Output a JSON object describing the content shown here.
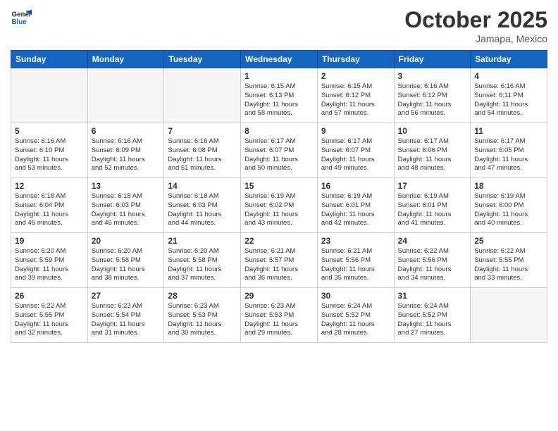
{
  "header": {
    "logo_general": "General",
    "logo_blue": "Blue",
    "month": "October 2025",
    "location": "Jamapa, Mexico"
  },
  "days_of_week": [
    "Sunday",
    "Monday",
    "Tuesday",
    "Wednesday",
    "Thursday",
    "Friday",
    "Saturday"
  ],
  "weeks": [
    [
      {
        "day": "",
        "info": ""
      },
      {
        "day": "",
        "info": ""
      },
      {
        "day": "",
        "info": ""
      },
      {
        "day": "1",
        "info": "Sunrise: 6:15 AM\nSunset: 6:13 PM\nDaylight: 11 hours\nand 58 minutes."
      },
      {
        "day": "2",
        "info": "Sunrise: 6:15 AM\nSunset: 6:12 PM\nDaylight: 11 hours\nand 57 minutes."
      },
      {
        "day": "3",
        "info": "Sunrise: 6:16 AM\nSunset: 6:12 PM\nDaylight: 11 hours\nand 56 minutes."
      },
      {
        "day": "4",
        "info": "Sunrise: 6:16 AM\nSunset: 6:11 PM\nDaylight: 11 hours\nand 54 minutes."
      }
    ],
    [
      {
        "day": "5",
        "info": "Sunrise: 6:16 AM\nSunset: 6:10 PM\nDaylight: 11 hours\nand 53 minutes."
      },
      {
        "day": "6",
        "info": "Sunrise: 6:16 AM\nSunset: 6:09 PM\nDaylight: 11 hours\nand 52 minutes."
      },
      {
        "day": "7",
        "info": "Sunrise: 6:16 AM\nSunset: 6:08 PM\nDaylight: 11 hours\nand 51 minutes."
      },
      {
        "day": "8",
        "info": "Sunrise: 6:17 AM\nSunset: 6:07 PM\nDaylight: 11 hours\nand 50 minutes."
      },
      {
        "day": "9",
        "info": "Sunrise: 6:17 AM\nSunset: 6:07 PM\nDaylight: 11 hours\nand 49 minutes."
      },
      {
        "day": "10",
        "info": "Sunrise: 6:17 AM\nSunset: 6:06 PM\nDaylight: 11 hours\nand 48 minutes."
      },
      {
        "day": "11",
        "info": "Sunrise: 6:17 AM\nSunset: 6:05 PM\nDaylight: 11 hours\nand 47 minutes."
      }
    ],
    [
      {
        "day": "12",
        "info": "Sunrise: 6:18 AM\nSunset: 6:04 PM\nDaylight: 11 hours\nand 46 minutes."
      },
      {
        "day": "13",
        "info": "Sunrise: 6:18 AM\nSunset: 6:03 PM\nDaylight: 11 hours\nand 45 minutes."
      },
      {
        "day": "14",
        "info": "Sunrise: 6:18 AM\nSunset: 6:03 PM\nDaylight: 11 hours\nand 44 minutes."
      },
      {
        "day": "15",
        "info": "Sunrise: 6:19 AM\nSunset: 6:02 PM\nDaylight: 11 hours\nand 43 minutes."
      },
      {
        "day": "16",
        "info": "Sunrise: 6:19 AM\nSunset: 6:01 PM\nDaylight: 11 hours\nand 42 minutes."
      },
      {
        "day": "17",
        "info": "Sunrise: 6:19 AM\nSunset: 6:01 PM\nDaylight: 11 hours\nand 41 minutes."
      },
      {
        "day": "18",
        "info": "Sunrise: 6:19 AM\nSunset: 6:00 PM\nDaylight: 11 hours\nand 40 minutes."
      }
    ],
    [
      {
        "day": "19",
        "info": "Sunrise: 6:20 AM\nSunset: 5:59 PM\nDaylight: 11 hours\nand 39 minutes."
      },
      {
        "day": "20",
        "info": "Sunrise: 6:20 AM\nSunset: 5:58 PM\nDaylight: 11 hours\nand 38 minutes."
      },
      {
        "day": "21",
        "info": "Sunrise: 6:20 AM\nSunset: 5:58 PM\nDaylight: 11 hours\nand 37 minutes."
      },
      {
        "day": "22",
        "info": "Sunrise: 6:21 AM\nSunset: 5:57 PM\nDaylight: 11 hours\nand 36 minutes."
      },
      {
        "day": "23",
        "info": "Sunrise: 6:21 AM\nSunset: 5:56 PM\nDaylight: 11 hours\nand 35 minutes."
      },
      {
        "day": "24",
        "info": "Sunrise: 6:22 AM\nSunset: 5:56 PM\nDaylight: 11 hours\nand 34 minutes."
      },
      {
        "day": "25",
        "info": "Sunrise: 6:22 AM\nSunset: 5:55 PM\nDaylight: 11 hours\nand 33 minutes."
      }
    ],
    [
      {
        "day": "26",
        "info": "Sunrise: 6:22 AM\nSunset: 5:55 PM\nDaylight: 11 hours\nand 32 minutes."
      },
      {
        "day": "27",
        "info": "Sunrise: 6:23 AM\nSunset: 5:54 PM\nDaylight: 11 hours\nand 31 minutes."
      },
      {
        "day": "28",
        "info": "Sunrise: 6:23 AM\nSunset: 5:53 PM\nDaylight: 11 hours\nand 30 minutes."
      },
      {
        "day": "29",
        "info": "Sunrise: 6:23 AM\nSunset: 5:53 PM\nDaylight: 11 hours\nand 29 minutes."
      },
      {
        "day": "30",
        "info": "Sunrise: 6:24 AM\nSunset: 5:52 PM\nDaylight: 11 hours\nand 28 minutes."
      },
      {
        "day": "31",
        "info": "Sunrise: 6:24 AM\nSunset: 5:52 PM\nDaylight: 11 hours\nand 27 minutes."
      },
      {
        "day": "",
        "info": ""
      }
    ]
  ]
}
